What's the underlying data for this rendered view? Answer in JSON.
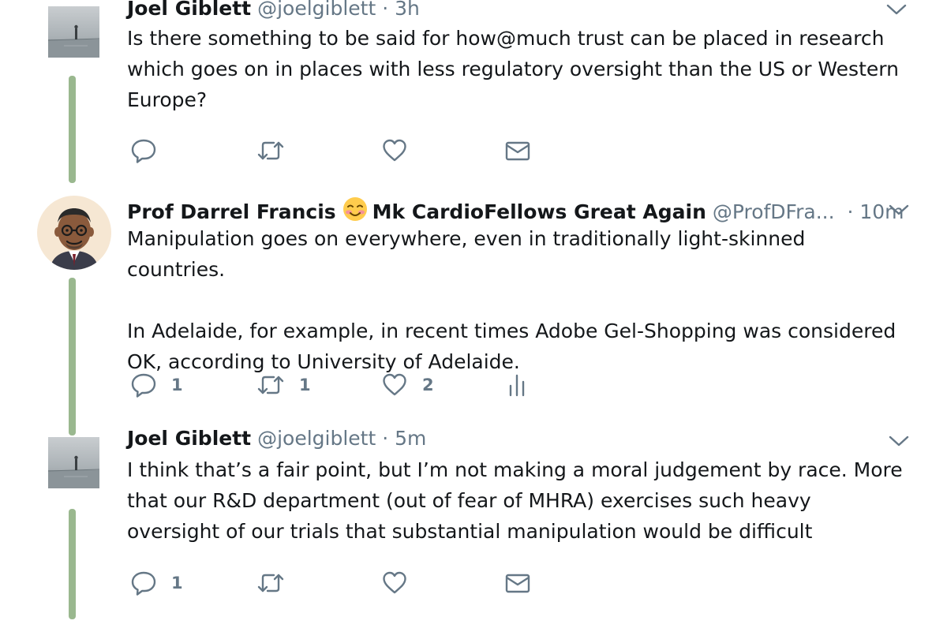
{
  "tweets": [
    {
      "author": "Joel Giblett",
      "handle": "@joelgiblett",
      "separator": "·",
      "time": "3h",
      "text": [
        "Is there something to be said for how@much trust can be placed in research which goes on in places with less regulatory oversight than the US or Western Europe?"
      ],
      "actions": {
        "reply": "",
        "retweet": "",
        "like": "",
        "dm": ""
      }
    },
    {
      "author": "Prof Darrel Francis",
      "emoji": "smiling-face-icon",
      "author_suffix": "Mk CardioFellows Great Again",
      "handle": "@ProfDFra...",
      "separator": "·",
      "time": "10m",
      "text": [
        "Manipulation goes on everywhere, even in traditionally light-skinned countries.",
        "In Adelaide, for example, in recent times Adobe Gel-Shopping was considered OK, according to University of Adelaide."
      ],
      "actions": {
        "reply": "1",
        "retweet": "1",
        "like": "2",
        "analytics": ""
      }
    },
    {
      "author": "Joel Giblett",
      "handle": "@joelgiblett",
      "separator": "·",
      "time": "5m",
      "text": [
        "I think that’s a fair point, but I’m not making a moral judgement by race. More that our R&D department (out of fear of MHRA) exercises such heavy oversight of our trials that substantial manipulation would be difficult"
      ],
      "actions": {
        "reply": "1",
        "retweet": "",
        "like": "",
        "dm": ""
      }
    }
  ],
  "colors": {
    "thread_line": "#9ab88f",
    "secondary_text": "#657786",
    "primary_text": "#14171a"
  }
}
